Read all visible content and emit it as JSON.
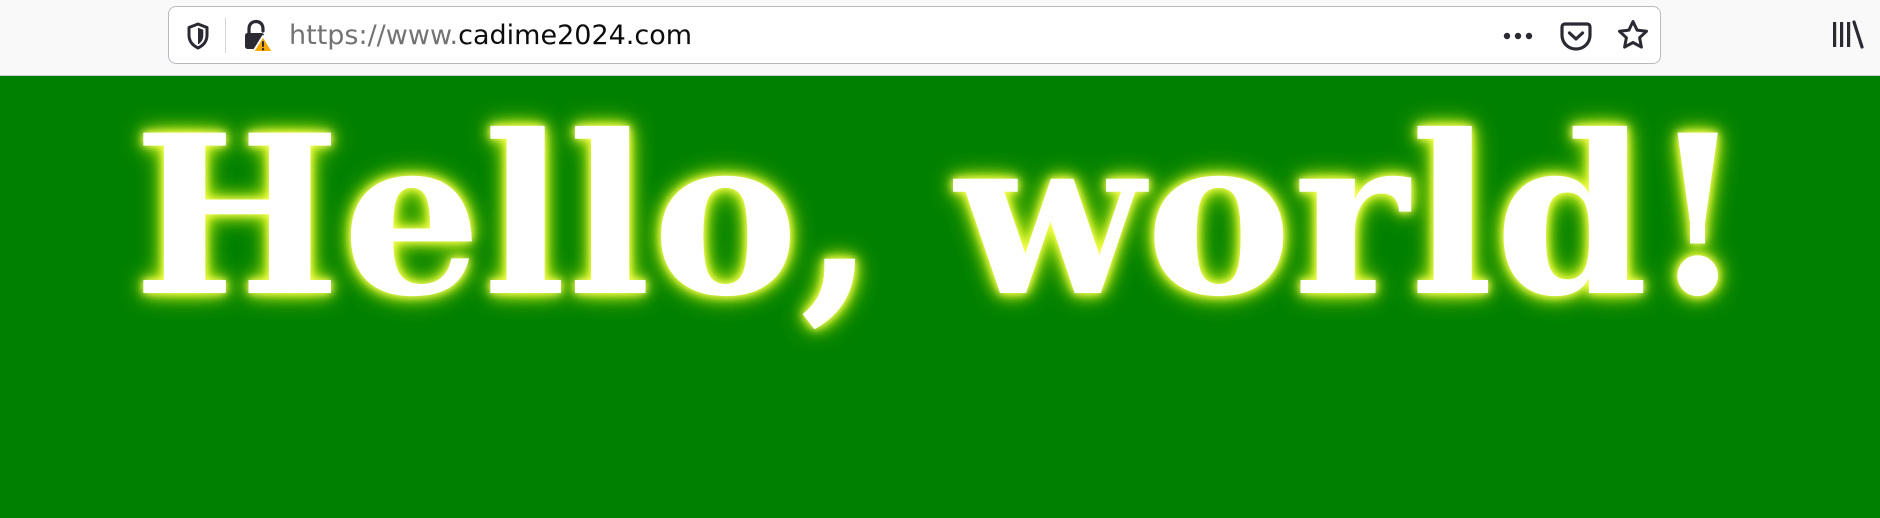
{
  "browser": {
    "url": {
      "prefix": "https://www.",
      "domain": "cadime2024.com"
    },
    "icons": {
      "tracking_protection": "shield-icon",
      "connection_security": "lock-warning-icon",
      "page_actions": "more-dots-icon",
      "pocket": "pocket-icon",
      "bookmark": "star-icon",
      "library": "library-icon"
    },
    "colors": {
      "toolbar_background": "#f9f9fa",
      "url_bar_border": "#b9b9c1",
      "url_prefix": "#737373",
      "url_domain": "#0c0c0d",
      "warning": "#f6a900"
    }
  },
  "page": {
    "heading": "Hello, world!",
    "colors": {
      "background": "#008000",
      "heading_text": "#ffffff",
      "heading_glow": "#d7ff00"
    }
  }
}
